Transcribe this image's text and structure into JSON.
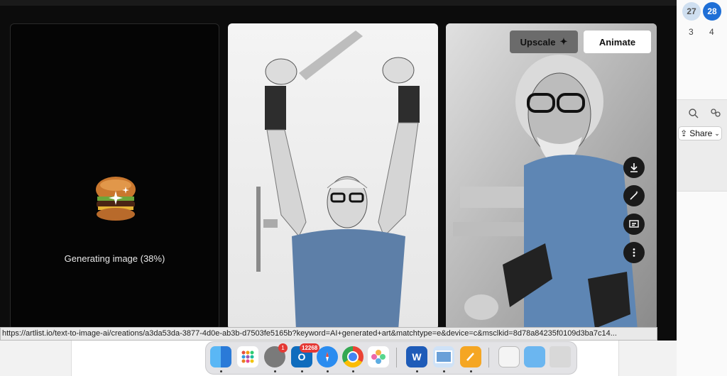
{
  "generating": {
    "label": "Generating image (38%)",
    "progress": 0.38
  },
  "actions": {
    "upscale_label": "Upscale",
    "animate_label": "Animate"
  },
  "side_actions": [
    "download-icon",
    "magic-wand-icon",
    "caption-icon",
    "more-vertical-icon"
  ],
  "status_url": "https://artlist.io/text-to-image-ai/creations/a3da53da-3877-4d0e-ab3b-d7503fe5165b?keyword=AI+generated+art&matchtype=e&device=c&msclkid=8d78a84235f0109d3ba7c14...",
  "calendar": {
    "day1": "27",
    "day2": "28",
    "next1": "3",
    "next2": "4"
  },
  "share": {
    "label": "Share"
  },
  "dock": {
    "outlook_badge": "12268",
    "settings_badge": "1"
  },
  "colors": {
    "accent": "#1f6fd6",
    "modal_bg": "#0c0c0c"
  }
}
